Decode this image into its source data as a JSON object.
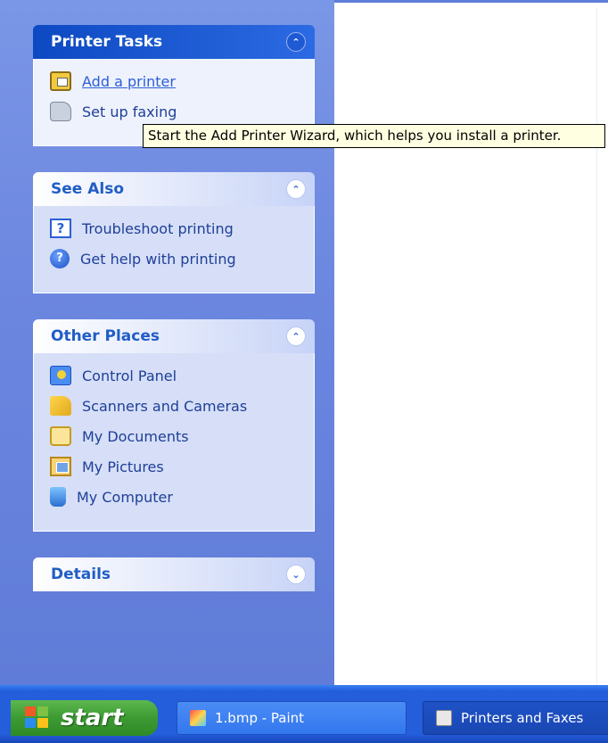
{
  "panels": {
    "printer_tasks": {
      "title": "Printer Tasks",
      "items": [
        {
          "label": "Add a printer",
          "icon": "add-printer-icon"
        },
        {
          "label": "Set up faxing",
          "icon": "fax-icon"
        }
      ]
    },
    "see_also": {
      "title": "See Also",
      "items": [
        {
          "label": "Troubleshoot printing",
          "icon": "question-icon"
        },
        {
          "label": "Get help with printing",
          "icon": "help-icon"
        }
      ]
    },
    "other_places": {
      "title": "Other Places",
      "items": [
        {
          "label": "Control Panel",
          "icon": "control-panel-icon"
        },
        {
          "label": "Scanners and Cameras",
          "icon": "scanner-icon"
        },
        {
          "label": "My Documents",
          "icon": "folder-icon"
        },
        {
          "label": "My Pictures",
          "icon": "pictures-icon"
        },
        {
          "label": "My Computer",
          "icon": "computer-icon"
        }
      ]
    },
    "details": {
      "title": "Details"
    }
  },
  "tooltip": {
    "text": "Start the Add Printer Wizard, which helps you install a printer."
  },
  "taskbar": {
    "start_label": "start",
    "tasks": [
      {
        "label": "1.bmp - Paint",
        "icon": "paint-icon"
      },
      {
        "label": "Printers and Faxes",
        "icon": "printer-icon"
      }
    ]
  },
  "colors": {
    "taskpane_blue": "#6b86df",
    "header_blue": "#215dc6",
    "taskbar_blue": "#245edb",
    "start_green": "#3c9a33",
    "tooltip_bg": "#ffffe1"
  }
}
